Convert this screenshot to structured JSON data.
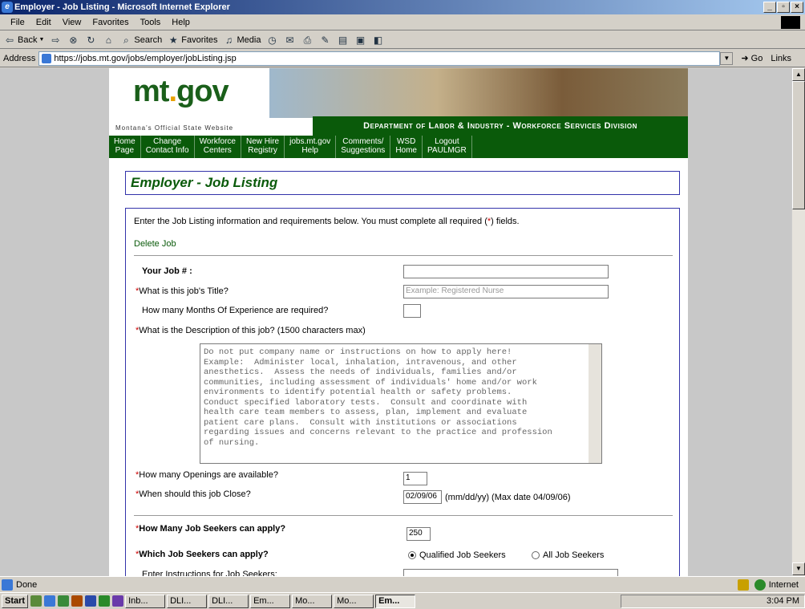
{
  "window": {
    "title": "Employer - Job Listing - Microsoft Internet Explorer"
  },
  "menu": [
    "File",
    "Edit",
    "View",
    "Favorites",
    "Tools",
    "Help"
  ],
  "toolbar": {
    "back": "Back",
    "search": "Search",
    "favorites": "Favorites",
    "media": "Media"
  },
  "address": {
    "label": "Address",
    "url": "https://jobs.mt.gov/jobs/employer/jobListing.jsp",
    "go": "Go",
    "links": "Links"
  },
  "banner": {
    "logo_main": "mt",
    "logo_dot": ".",
    "logo_tld": "gov",
    "tagline": "Montana's Official State Website",
    "department": "Department of Labor & Industry - Workforce Services Division"
  },
  "nav": [
    {
      "label": "Home\nPage"
    },
    {
      "label": "Change\nContact Info"
    },
    {
      "label": "Workforce\nCenters"
    },
    {
      "label": "New Hire\nRegistry"
    },
    {
      "label": "jobs.mt.gov\nHelp"
    },
    {
      "label": "Comments/\nSuggestions"
    },
    {
      "label": "WSD\nHome"
    },
    {
      "label": "Logout\nPAULMGR"
    }
  ],
  "page": {
    "title": "Employer - Job Listing"
  },
  "form": {
    "intro_a": "Enter the Job Listing information and requirements below. You must complete all required (",
    "intro_star": "*",
    "intro_b": ") fields.",
    "delete_link": "Delete Job",
    "job_num_label": "Your Job # :",
    "job_num_value": "",
    "title_label": "What is this job's Title?",
    "title_placeholder": "Example:  Registered Nurse",
    "months_label": "How many Months Of Experience are required?",
    "months_value": "",
    "desc_label": "What is the Description of this job?  (1500 characters max)",
    "desc_text": "Do not put company name or instructions on how to apply here!\nExample:  Administer local, inhalation, intravenous, and other\nanesthetics.  Assess the needs of individuals, families and/or\ncommunities, including assessment of individuals' home and/or work\nenvironments to identify potential health or safety problems.\nConduct specified laboratory tests.  Consult and coordinate with\nhealth care team members to assess, plan, implement and evaluate\npatient care plans.  Consult with institutions or associations\nregarding issues and concerns relevant to the practice and profession\nof nursing.",
    "openings_label": "How many Openings are available?",
    "openings_value": "1",
    "close_label": "When should this job Close?",
    "close_value": "02/09/06",
    "close_hint": "(mm/dd/yy)  (Max date 04/09/06)",
    "seekers_count_label": "How Many Job Seekers can apply?",
    "seekers_count_value": "250",
    "which_label": "Which Job Seekers can apply?",
    "radio_qualified": "Qualified Job Seekers",
    "radio_all": "All Job Seekers",
    "selected": "Qualified Job Seekers",
    "instructions_label": "Enter Instructions for Job Seekers:"
  },
  "status": {
    "text": "Done",
    "zone": "Internet"
  },
  "taskbar": {
    "start": "Start",
    "tasks": [
      "Inb...",
      "DLI...",
      "DLI...",
      "Em...",
      "Mo...",
      "Mo...",
      "Em..."
    ],
    "clock": "3:04 PM"
  }
}
